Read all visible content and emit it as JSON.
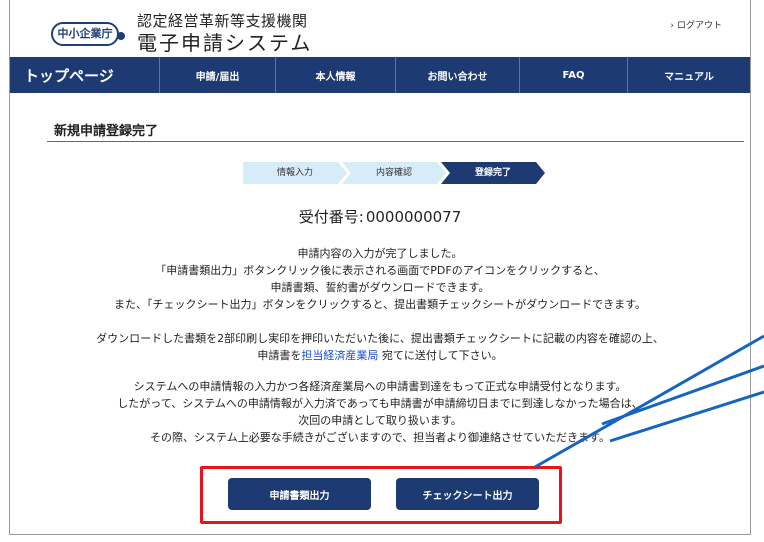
{
  "header": {
    "logo_text": "中小企業庁",
    "org_line": "認定経営革新等支援機関",
    "system_title": "電子申請システム",
    "logout_label": "ログアウト"
  },
  "nav": {
    "items": [
      {
        "label": "トップページ"
      },
      {
        "label": "申請/届出"
      },
      {
        "label": "本人情報"
      },
      {
        "label": "お問い合わせ"
      },
      {
        "label": "FAQ"
      },
      {
        "label": "マニュアル"
      }
    ]
  },
  "page": {
    "title": "新規申請登録完了",
    "steps": [
      {
        "label": "情報入力",
        "active": false
      },
      {
        "label": "内容確認",
        "active": false
      },
      {
        "label": "登録完了",
        "active": true
      }
    ],
    "receipt_label": "受付番号:",
    "receipt_number": "0000000077",
    "paragraph1": [
      "申請内容の入力が完了しました。",
      "「申請書類出力」ボタンクリック後に表示される画面でPDFのアイコンをクリックすると、",
      "申請書類、誓約書がダウンロードできます。",
      "また、「チェックシート出力」ボタンをクリックすると、提出書類チェックシートがダウンロードできます。"
    ],
    "paragraph2_line1": "ダウンロードした書類を2部印刷し実印を押印いただいた後に、提出書類チェックシートに記載の内容を確認の上、",
    "paragraph2_line2_before": "申請書を",
    "paragraph2_link": "担当経済産業局",
    "paragraph2_line2_after": " 宛てに送付して下さい。",
    "paragraph3": [
      "システムへの申請情報の入力かつ各経済産業局への申請書到達をもって正式な申請受付となります。",
      "したがって、システムへの申請情報が入力済であっても申請書が申請締切日までに到達しなかった場合は、",
      "次回の申請として取り扱います。",
      "その際、システム上必要な手続きがございますので、担当者より御連絡させていただきます。"
    ]
  },
  "buttons": {
    "output_documents": "申請書類出力",
    "output_checksheet": "チェックシート出力"
  },
  "colors": {
    "navy": "#1d3b72",
    "step_inactive": "#d6ecf7",
    "highlight": "#e8131b",
    "annotation_arrow": "#1565c0",
    "link": "#1a4fc4"
  }
}
